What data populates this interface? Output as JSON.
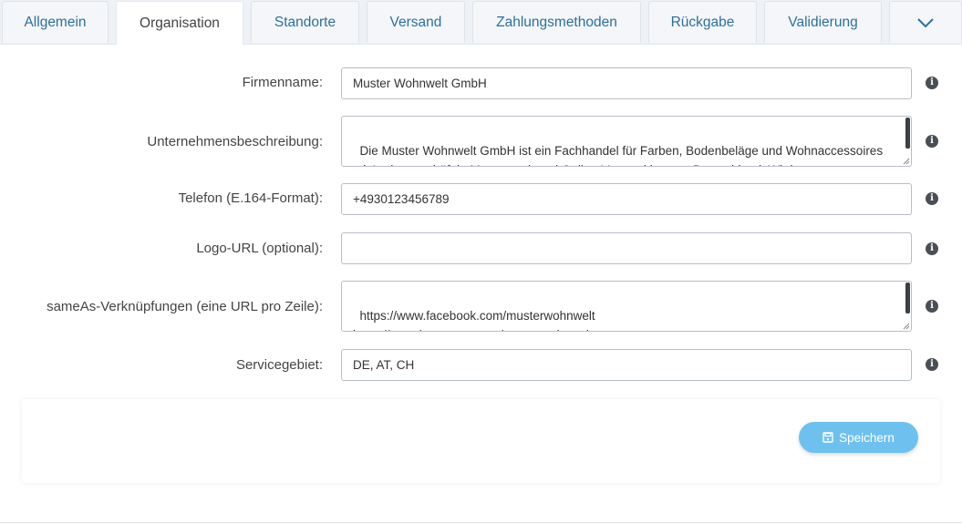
{
  "tabs": [
    {
      "label": "Allgemein",
      "active": false
    },
    {
      "label": "Organisation",
      "active": true
    },
    {
      "label": "Standorte",
      "active": false
    },
    {
      "label": "Versand",
      "active": false
    },
    {
      "label": "Zahlungsmethoden",
      "active": false
    },
    {
      "label": "Rückgabe",
      "active": false
    },
    {
      "label": "Validierung",
      "active": false
    }
  ],
  "tab_more_icon": "chevron-down-icon",
  "form": {
    "company_name": {
      "label": "Firmenname:",
      "value": "Muster Wohnwelt GmbH"
    },
    "description": {
      "label": "Unternehmensbeschreibung:",
      "value": "Die Muster Wohnwelt GmbH ist ein Fachhandel für Farben, Bodenbeläge und Wohnaccessoires mit Ladengeschäft in Musterstadt und Online-Versand in ganz Deutschland. Wir beraten"
    },
    "phone": {
      "label": "Telefon (E.164-Format):",
      "value": "+4930123456789"
    },
    "logo_url": {
      "label": "Logo-URL (optional):",
      "value": ""
    },
    "same_as": {
      "label": "sameAs-Verknüpfungen (eine URL pro Zeile):",
      "value": "https://www.facebook.com/musterwohnwelt\nhttps://www.instagram.com/musterwohnwelt"
    },
    "service_area": {
      "label": "Servicegebiet:",
      "value": "DE, AT, CH"
    }
  },
  "info_icon": "info-icon",
  "save_button": {
    "label": "Speichern",
    "icon": "save-icon"
  },
  "colors": {
    "tab_text": "#2f6f9a",
    "save_button": "#6ec1ee",
    "info_icon": "#4a4f56"
  }
}
